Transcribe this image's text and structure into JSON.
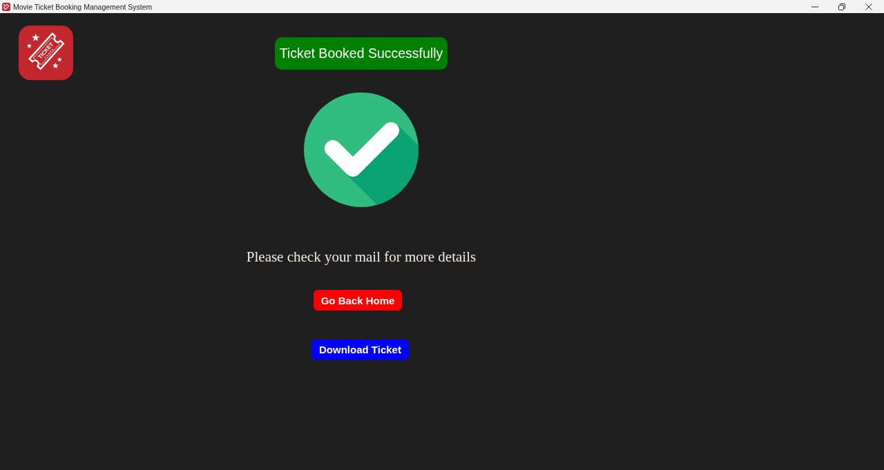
{
  "window": {
    "title": "Movie Ticket Booking Management System"
  },
  "logo": {
    "text": "TICKET"
  },
  "banner": {
    "text": "Ticket Booked Successfully"
  },
  "message": "Please check your mail for more details",
  "buttons": [
    {
      "label": "Go Back Home",
      "color": "#ff0000"
    },
    {
      "label": "Download Ticket",
      "color": "#0000ff"
    }
  ]
}
